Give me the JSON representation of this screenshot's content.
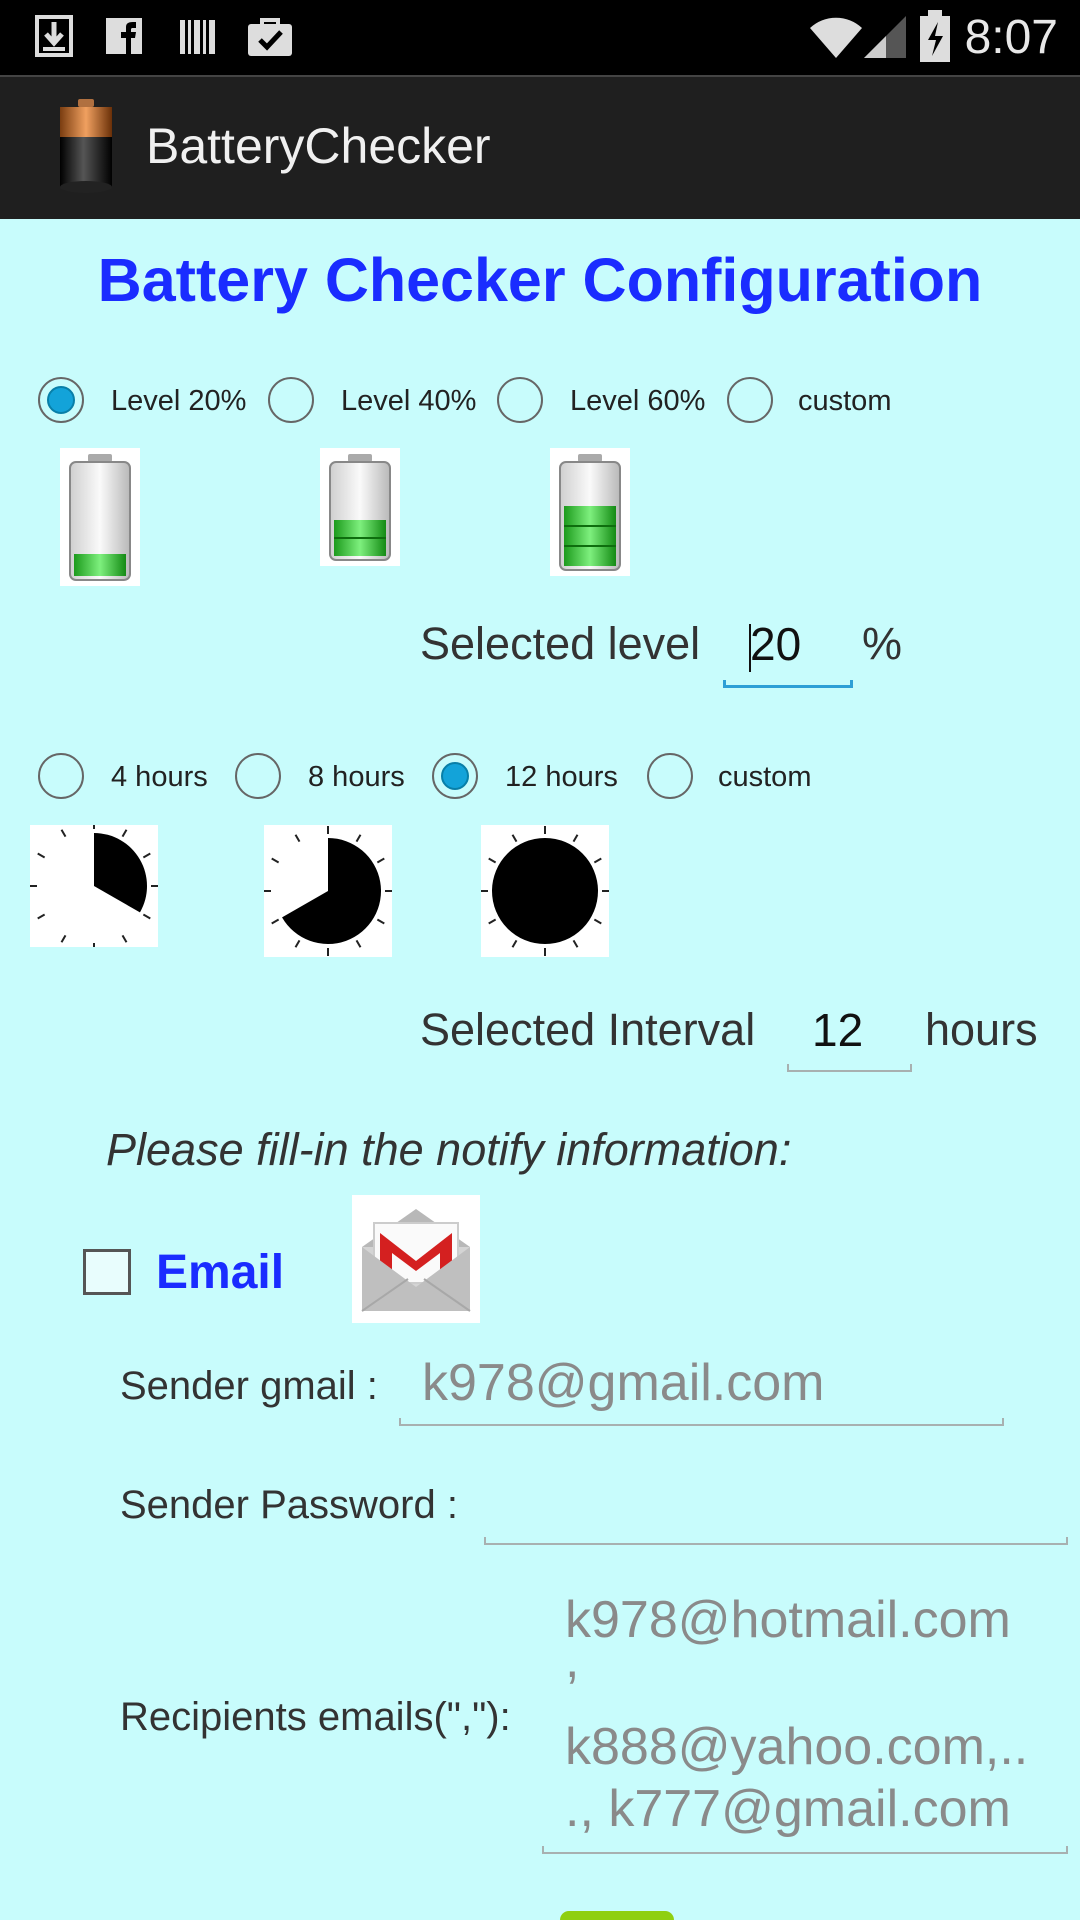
{
  "status_bar": {
    "time": "8:07",
    "left_icons": [
      "download-icon",
      "facebook-icon",
      "barcode-icon",
      "briefcase-check-icon"
    ],
    "right_icons": [
      "wifi-icon",
      "signal-icon",
      "battery-icon"
    ]
  },
  "action_bar": {
    "app_name": "BatteryChecker",
    "app_icon": "battery-app-icon"
  },
  "page_title": "Battery Checker Configuration",
  "level_section": {
    "options": [
      {
        "label": "Level 20%",
        "selected": true
      },
      {
        "label": "Level 40%",
        "selected": false
      },
      {
        "label": "Level 60%",
        "selected": false
      },
      {
        "label": "custom",
        "selected": false
      }
    ],
    "images": [
      {
        "icon": "battery-20-icon",
        "fill": 0.2
      },
      {
        "icon": "battery-40-icon",
        "fill": 0.4
      },
      {
        "icon": "battery-60-icon",
        "fill": 0.6
      }
    ],
    "selected_label": "Selected level",
    "selected_value": "20",
    "unit": "%"
  },
  "interval_section": {
    "options": [
      {
        "label": "4 hours",
        "selected": false
      },
      {
        "label": "8 hours",
        "selected": false
      },
      {
        "label": "12 hours",
        "selected": true
      },
      {
        "label": "custom",
        "selected": false
      }
    ],
    "images": [
      {
        "icon": "clock-4-hours-icon",
        "fraction": 0.333
      },
      {
        "icon": "clock-8-hours-icon",
        "fraction": 0.667
      },
      {
        "icon": "clock-12-hours-icon",
        "fraction": 1.0
      }
    ],
    "selected_label": "Selected Interval",
    "selected_value": "12",
    "unit": "hours"
  },
  "notify": {
    "heading": "Please fill-in the notify information:",
    "email_label": "Email",
    "email_checked": false,
    "gmail_icon": "gmail-icon",
    "sender_gmail_label": "Sender gmail :",
    "sender_gmail_hint": "k978@gmail.com",
    "sender_password_label": "Sender Password :",
    "sender_password_value": "",
    "recipients_label": "Recipients emails(\",\"):",
    "recipients_hint_lines": [
      "k978@hotmail.com",
      ",",
      "k888@yahoo.com,..",
      "., k777@gmail.com"
    ]
  },
  "colors": {
    "background": "#c8fcfc",
    "title": "#1a2cff",
    "accent": "#13a3d9"
  }
}
